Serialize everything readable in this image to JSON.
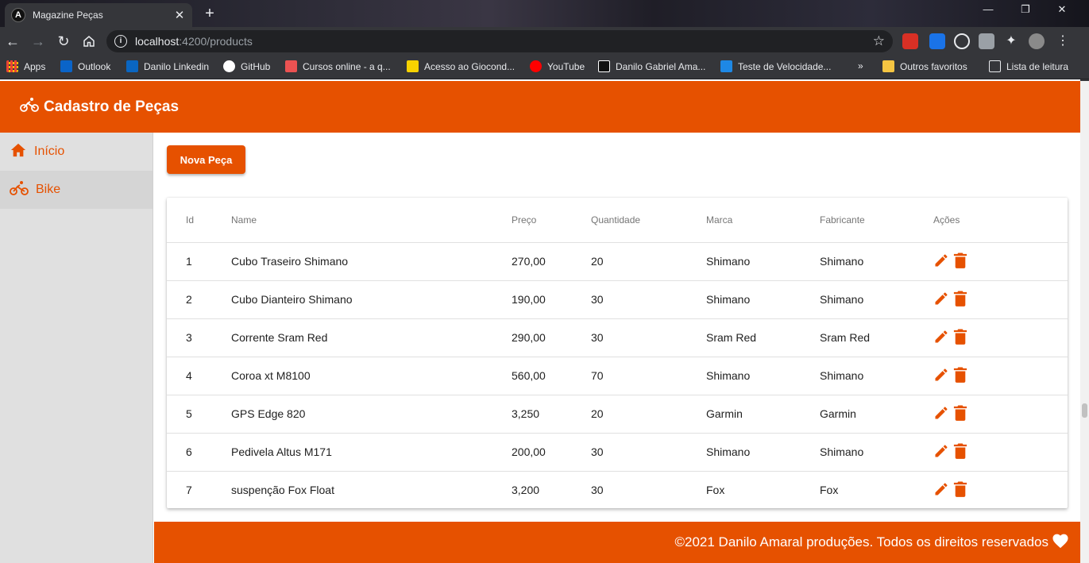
{
  "browser": {
    "tab_title": "Magazine Peças",
    "tab_favicon": "A",
    "url_host": "localhost",
    "url_path": ":4200/products",
    "bookmarks": [
      {
        "label": "Apps",
        "icon": "apps-grid-icon",
        "color": "#e8eaed"
      },
      {
        "label": "Outlook",
        "icon": "outlook-icon",
        "color": "#0a64c8"
      },
      {
        "label": "Danilo Linkedin",
        "icon": "linkedin-icon",
        "color": "#0a66c2"
      },
      {
        "label": "GitHub",
        "icon": "github-icon",
        "color": "#ffffff"
      },
      {
        "label": "Cursos online - a q...",
        "icon": "udemy-icon",
        "color": "#ec5252"
      },
      {
        "label": "Acesso ao Giocond...",
        "icon": "giocond-icon",
        "color": "#f7d200"
      },
      {
        "label": "YouTube",
        "icon": "youtube-icon",
        "color": "#ff0000"
      },
      {
        "label": "Danilo Gabriel Ama...",
        "icon": "bookmark-icon",
        "color": "#ffffff"
      },
      {
        "label": "Teste de Velocidade...",
        "icon": "speedtest-icon",
        "color": "#1e88e5"
      },
      {
        "label": "Outros favoritos",
        "icon": "folder-icon",
        "color": "#f5c542"
      },
      {
        "label": "Lista de leitura",
        "icon": "reading-list-icon",
        "color": "#e8eaed"
      }
    ],
    "overflow_label": "»"
  },
  "app": {
    "title": "Cadastro de Peças",
    "accent": "#e65100",
    "nav": [
      {
        "label": "Início",
        "icon": "home-icon",
        "active": false
      },
      {
        "label": "Bike",
        "icon": "bike-icon",
        "active": true
      }
    ],
    "new_button": "Nova Peça",
    "table": {
      "headers": [
        "Id",
        "Name",
        "Preço",
        "Quantidade",
        "Marca",
        "Fabricante",
        "Ações"
      ],
      "rows": [
        {
          "id": "1",
          "name": "Cubo Traseiro Shimano",
          "price": "270,00",
          "qty": "20",
          "brand": "Shimano",
          "maker": "Shimano"
        },
        {
          "id": "2",
          "name": "Cubo Dianteiro Shimano",
          "price": "190,00",
          "qty": "30",
          "brand": "Shimano",
          "maker": "Shimano"
        },
        {
          "id": "3",
          "name": "Corrente Sram Red",
          "price": "290,00",
          "qty": "30",
          "brand": "Sram Red",
          "maker": "Sram Red"
        },
        {
          "id": "4",
          "name": "Coroa xt M8100",
          "price": "560,00",
          "qty": "70",
          "brand": "Shimano",
          "maker": "Shimano"
        },
        {
          "id": "5",
          "name": "GPS Edge 820",
          "price": "3,250",
          "qty": "20",
          "brand": "Garmin",
          "maker": "Garmin"
        },
        {
          "id": "6",
          "name": "Pedivela Altus M171",
          "price": "200,00",
          "qty": "30",
          "brand": "Shimano",
          "maker": "Shimano"
        },
        {
          "id": "7",
          "name": "suspenção Fox Float",
          "price": "3,200",
          "qty": "30",
          "brand": "Fox",
          "maker": "Fox"
        }
      ]
    },
    "footer_text": "©2021 Danilo Amaral produções. Todos os direitos reservados",
    "footer_icon": "heart-icon"
  }
}
